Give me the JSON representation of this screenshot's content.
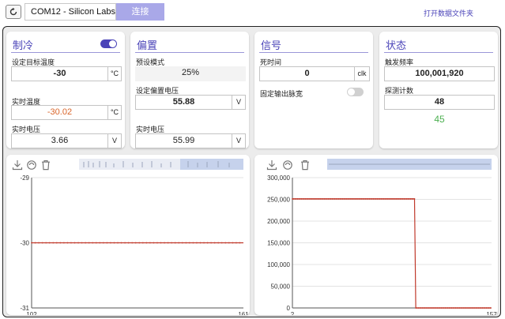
{
  "topbar": {
    "port": "COM12 - Silicon Labs",
    "connect_label": "连接",
    "open_folder_label": "打开数据文件夹"
  },
  "cooling": {
    "title": "制冷",
    "toggle_on": true,
    "target_temp_label": "设定目标温度",
    "target_temp_value": "-30",
    "target_temp_unit": "°C",
    "actual_temp_label": "实时温度",
    "actual_temp_value": "-30.02",
    "actual_temp_unit": "°C",
    "voltage_label": "实时电压",
    "voltage_value": "3.66",
    "voltage_unit": "V"
  },
  "bias": {
    "title": "偏置",
    "preset_label": "预设模式",
    "preset_value": "25%",
    "set_bias_label": "设定偏置电压",
    "set_bias_value": "55.88",
    "set_bias_unit": "V",
    "actual_label": "实时电压",
    "actual_value": "55.99",
    "actual_unit": "V"
  },
  "signal": {
    "title": "信号",
    "dead_time_label": "死时间",
    "dead_time_value": "0",
    "dead_time_unit": "clk",
    "fixed_pulse_label": "固定输出脉宽",
    "fixed_pulse_on": false
  },
  "status": {
    "title": "状态",
    "trigger_label": "触发频率",
    "trigger_value": "100,001,920",
    "count_label": "探测计数",
    "count_value": "48",
    "extra_value": "45",
    "extra_color": "#4caf50"
  },
  "icons": [
    "refresh-icon",
    "download-icon",
    "reset-icon",
    "trash-icon"
  ],
  "colors": {
    "accent": "#4a43b8",
    "line": "#c0392b",
    "orange": "#d9652a"
  },
  "chart_data": [
    {
      "type": "line",
      "title": "",
      "xlabel": "",
      "ylabel": "",
      "xlim": [
        102,
        161
      ],
      "ylim": [
        -31,
        -29
      ],
      "x_ticks": [
        "102",
        "161"
      ],
      "y_ticks": [
        "-29",
        "-30",
        "-31"
      ],
      "grid": true,
      "series": [
        {
          "x": [
            102,
            161
          ],
          "values": [
            -30.0,
            -30.0
          ]
        }
      ]
    },
    {
      "type": "line",
      "title": "",
      "xlabel": "",
      "ylabel": "",
      "xlim": [
        2,
        157
      ],
      "ylim": [
        0,
        300000
      ],
      "x_ticks": [
        "2",
        "157"
      ],
      "y_ticks": [
        "300,000",
        "250,000",
        "200,000",
        "150,000",
        "100,000",
        "50,000",
        "0"
      ],
      "grid": true,
      "series": [
        {
          "x": [
            2,
            97,
            98,
            157
          ],
          "values": [
            251000,
            251000,
            0,
            0
          ]
        }
      ]
    }
  ]
}
